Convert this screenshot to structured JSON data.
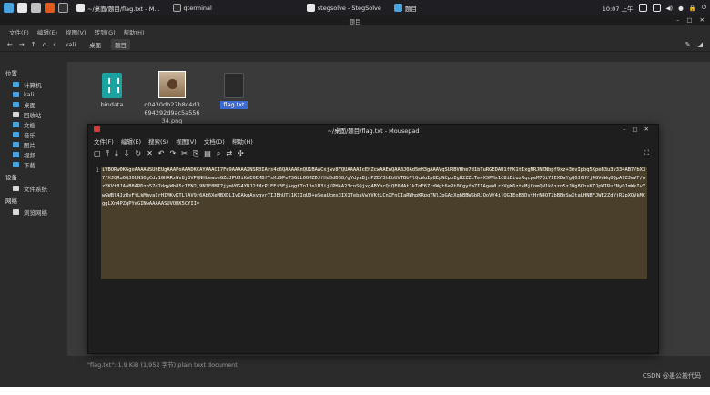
{
  "taskbar": {
    "tasks": [
      {
        "label": "~/桌面/题目/flag.txt - M...",
        "color": "#e9e9e9"
      },
      {
        "label": "qterminal",
        "color": "#2b2b2b"
      },
      {
        "label": "stegsolve - StegSolve",
        "color": "#e9e9e9"
      },
      {
        "label": "题目",
        "color": "#4aa3df"
      }
    ],
    "clock": "10:07 上午"
  },
  "file_manager": {
    "title": "题目",
    "menu": [
      "文件(F)",
      "编辑(E)",
      "视图(V)",
      "转到(G)",
      "帮助(H)"
    ],
    "breadcrumbs": [
      "kali",
      "桌面",
      "题目"
    ],
    "sidebar": {
      "places_header": "位置",
      "places": [
        "计算机",
        "kali",
        "桌面",
        "回收站",
        "文档",
        "音乐",
        "图片",
        "视频",
        "下载"
      ],
      "devices_header": "设备",
      "devices": [
        "文件系统"
      ],
      "network_header": "网络",
      "network": [
        "浏览网络"
      ]
    },
    "files": [
      {
        "name": "bindata"
      },
      {
        "name": "d0430db27b8c4d3694292d9ac5a55634.png"
      },
      {
        "name": "flag.txt"
      }
    ],
    "status": "\"flag.txt\": 1.9 KiB (1,952 字节) plain text document"
  },
  "mousepad": {
    "title": "~/桌面/题目/flag.txt - Mousepad",
    "menu": [
      "文件(F)",
      "编辑(E)",
      "搜索(S)",
      "视图(V)",
      "文档(D)",
      "帮助(H)"
    ],
    "line_number": "1",
    "content": "iVBORw0KGgoAAAANSUhEUgAAAPoAAADKCAYAAACI7Fe9AAAAAXNSR0IArs4c6QAAAARnQU1BAACxjwv8YQUAAAAJcEhZcwAAEnQAABJ0Ad5mH3gAAAVqSURBVHhe7d1bTuRGEDAU1fFK1tIxgNRJNZNbpf9xz+3mvIpbq5KpeB3u3v334AB7/bX37/XJQRuOQJOUNSOgCdz1GHARzWv8j0VPQNHbewoeGZqJPUJiKmE6EMBfTsKi9PeTSGLLOOMZDJfHd0dDS8/gYdyaBjnPZEY3hEbUVTBbTlQcWuIp8EpNCpbIgH2ZZLTm+XSPMx1C8iDiuzRqcpeM7Qi7IEXDaYgQ0J6HYj4GVeWq0QpA9ZJmVF/wzYKVt8JAAB8ARDzb57d7dqyWb85cIFN2j9N3F8M77jymV0G4YNJ2fMrP1EEi3Ej+qgtTn1UnlN3ij/PHAA23cnSQjxg4BYhcQtQF6MAt1kTnE6ZrdWgt6eRt0CgyfmZIlAgeWLrzVgW6ztkMjCnmQN1k8zzn5zJWg8ChsKZJpWIRuFNyQJmWxIvYwGWBl4JzRyFtLkMmvaIrHIMKvKTLlAV9r6Ab6XeMBXDLIvIAkgAxvqyr7IJEhUTl1K1IqU0+eSeaUcmx3IX1TebaVwYVKtLCnXFnCIaRWhpKRpqTNlJpGAcXgbBBWSbRJQoVY4ijQGIEoB3DvtHrN4QTZbBBnSwXtaLHNBFJWE2ZdVjR2pXQVkMCggLXn4PZqPYeGINwAAAAASUVORK5CYII="
  },
  "watermark": "CSDN @愚公搬代码"
}
